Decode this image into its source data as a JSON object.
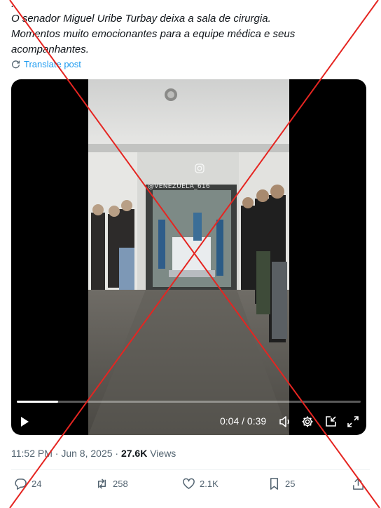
{
  "post": {
    "leading_dot": ".",
    "lines": [
      "O senador Miguel Uribe Turbay deixa a sala de cirurgia.",
      "Momentos muito emocionantes para a equipe médica e seus",
      "acompanhantes."
    ],
    "translate_label": "Translate post"
  },
  "video": {
    "watermark": "@VENEZUELA_616",
    "progress_fraction": 0.12,
    "current_time": "0:04",
    "duration": "0:39",
    "time_separator": " / "
  },
  "meta": {
    "time": "11:52 PM",
    "date": "Jun 8, 2025",
    "separator": " · ",
    "views_count": "27.6K",
    "views_label": "Views"
  },
  "actions": {
    "replies": "24",
    "reposts": "258",
    "likes": "2.1K",
    "bookmarks": "25"
  },
  "colors": {
    "text": "#0f1419",
    "secondary": "#536471",
    "link": "#1d9bf0",
    "overlay_x": "#e52521"
  }
}
